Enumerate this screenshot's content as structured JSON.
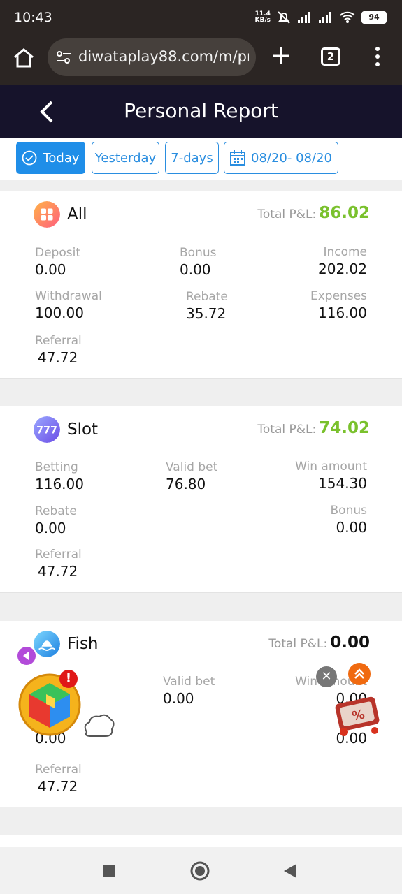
{
  "status": {
    "time": "10:43",
    "speed_top": "11.4",
    "speed_unit": "KB/s",
    "battery": "94"
  },
  "browser": {
    "url": "diwataplay88.com/m/pr",
    "tab_count": "2"
  },
  "header": {
    "title": "Personal Report"
  },
  "filters": {
    "today": "Today",
    "yesterday": "Yesterday",
    "week": "7-days",
    "range": "08/20- 08/20"
  },
  "pl_label": "Total P&L:",
  "all": {
    "name": "All",
    "total": "86.02",
    "deposit_label": "Deposit",
    "deposit": "0.00",
    "bonus_label": "Bonus",
    "bonus": "0.00",
    "income_label": "Income",
    "income": "202.02",
    "withdrawal_label": "Withdrawal",
    "withdrawal": "100.00",
    "rebate_label": "Rebate",
    "rebate": "35.72",
    "expenses_label": "Expenses",
    "expenses": "116.00",
    "referral_label": "Referral",
    "referral": "47.72"
  },
  "slot": {
    "name": "Slot",
    "total": "74.02",
    "betting_label": "Betting",
    "betting": "116.00",
    "validbet_label": "Valid bet",
    "validbet": "76.80",
    "win_label": "Win amount",
    "win": "154.30",
    "rebate_label": "Rebate",
    "rebate": "0.00",
    "bonus_label": "Bonus",
    "bonus": "0.00",
    "referral_label": "Referral",
    "referral": "47.72"
  },
  "fish": {
    "name": "Fish",
    "total": "0.00",
    "validbet_label": "Valid bet",
    "validbet": "0.00",
    "win_label": "Win amount",
    "win": "0.00",
    "rebate": "0.00",
    "bonus": "0.00",
    "referral_label": "Referral",
    "referral": "47.72"
  },
  "overlay": {
    "badge": "!",
    "close": "✕"
  },
  "colors": {
    "accent": "#1f8ee8",
    "positive": "#7ac12d",
    "header_bg": "#16132b"
  }
}
